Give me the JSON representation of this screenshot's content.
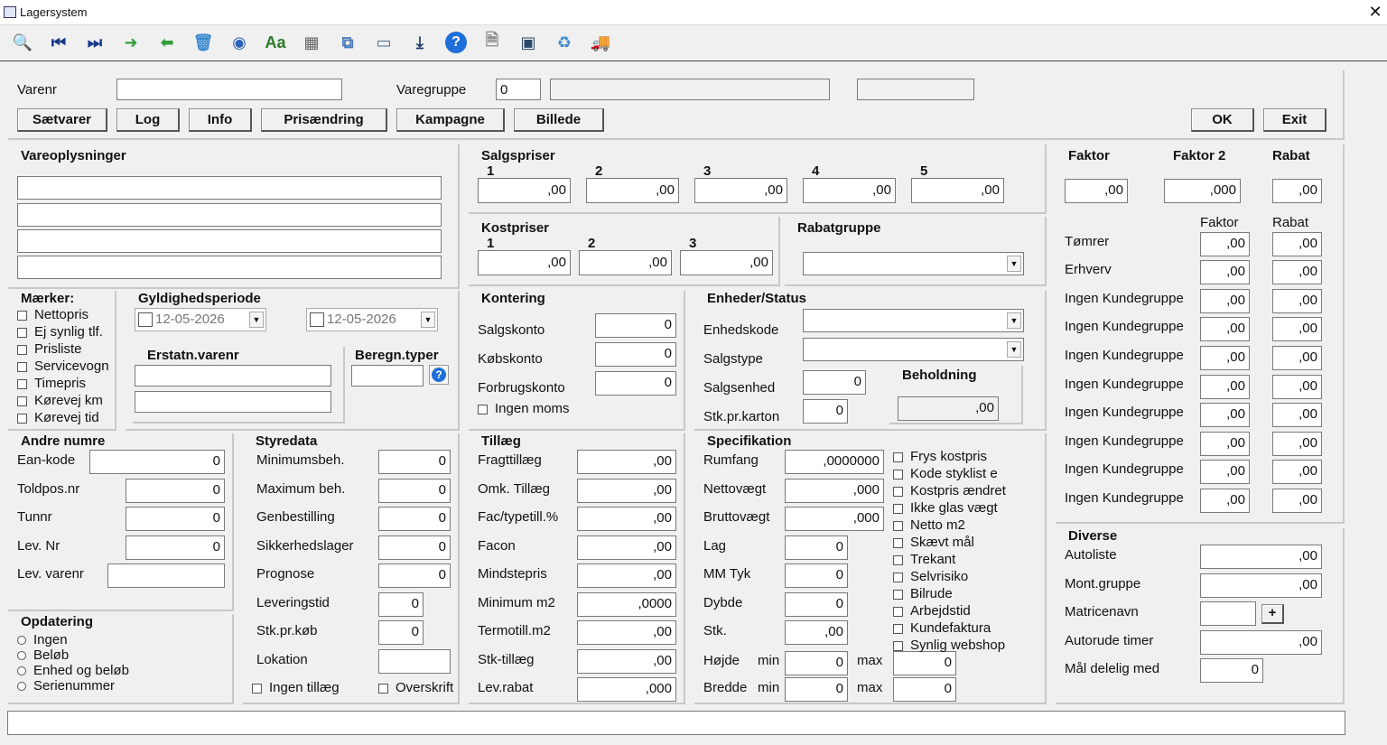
{
  "window": {
    "title": "Lagersystem",
    "close": "✕"
  },
  "toolbar": [
    {
      "name": "search-icon",
      "glyph": "🔍",
      "color": "#3a6fb0"
    },
    {
      "name": "first-record-icon",
      "glyph": "⏮",
      "color": "#1a3a8a"
    },
    {
      "name": "last-record-icon",
      "glyph": "⏭",
      "color": "#1a3a8a"
    },
    {
      "name": "forward-arrow-icon",
      "glyph": "➜",
      "color": "#2e9e3a"
    },
    {
      "name": "back-arrow-icon",
      "glyph": "⬅",
      "color": "#2e9e3a"
    },
    {
      "name": "trash-icon",
      "glyph": "🗑",
      "color": "#3a8ad0"
    },
    {
      "name": "disc-icon",
      "glyph": "◉",
      "color": "#2a62b8"
    },
    {
      "name": "font-icon",
      "glyph": "Aa",
      "color": "#2a7a2a"
    },
    {
      "name": "calculator-icon",
      "glyph": "▦",
      "color": "#666"
    },
    {
      "name": "copy-icon",
      "glyph": "⧉",
      "color": "#4a7ab8"
    },
    {
      "name": "print-icon",
      "glyph": "▭",
      "color": "#4a6a8a"
    },
    {
      "name": "download-icon",
      "glyph": "⤓",
      "color": "#1a3a6a"
    },
    {
      "name": "help-icon",
      "glyph": "?",
      "color": "#1e6fd9"
    },
    {
      "name": "document-icon",
      "glyph": "🗎",
      "color": "#888"
    },
    {
      "name": "screen-icon",
      "glyph": "▣",
      "color": "#2a4a6a"
    },
    {
      "name": "recycle-icon",
      "glyph": "♻",
      "color": "#3a8ad0"
    },
    {
      "name": "truck-icon",
      "glyph": "🚚",
      "color": "#2a6a3a"
    }
  ],
  "top": {
    "varenr_label": "Varenr",
    "varenr_value": "",
    "varegruppe_label": "Varegruppe",
    "varegruppe_value": "0",
    "varegruppe_name": "",
    "extra": ""
  },
  "buttons": {
    "saetvarer": "Sætvarer",
    "log": "Log",
    "info": "Info",
    "prisaendring": "Prisændring",
    "kampagne": "Kampagne",
    "billede": "Billede",
    "ok": "OK",
    "exit": "Exit"
  },
  "vareopl": {
    "title": "Vareoplysninger",
    "lines": [
      "",
      "",
      "",
      ""
    ]
  },
  "salgspriser": {
    "title": "Salgspriser",
    "cols": [
      "1",
      "2",
      "3",
      "4",
      "5"
    ],
    "values": [
      ",00",
      ",00",
      ",00",
      ",00",
      ",00"
    ]
  },
  "kostpriser": {
    "title": "Kostpriser",
    "cols": [
      "1",
      "2",
      "3"
    ],
    "values": [
      ",00",
      ",00",
      ",00"
    ]
  },
  "rabatgruppe": {
    "title": "Rabatgruppe",
    "value": ""
  },
  "faktor": {
    "h1": "Faktor",
    "h2": "Faktor 2",
    "h3": "Rabat",
    "v1": ",00",
    "v2": ",000",
    "v3": ",00",
    "sub_faktor": "Faktor",
    "sub_rabat": "Rabat",
    "rows": [
      {
        "label": "Tømrer",
        "faktor": ",00",
        "rabat": ",00"
      },
      {
        "label": "Erhverv",
        "faktor": ",00",
        "rabat": ",00"
      },
      {
        "label": "Ingen Kundegruppe",
        "faktor": ",00",
        "rabat": ",00"
      },
      {
        "label": "Ingen Kundegruppe",
        "faktor": ",00",
        "rabat": ",00"
      },
      {
        "label": "Ingen Kundegruppe",
        "faktor": ",00",
        "rabat": ",00"
      },
      {
        "label": "Ingen Kundegruppe",
        "faktor": ",00",
        "rabat": ",00"
      },
      {
        "label": "Ingen Kundegruppe",
        "faktor": ",00",
        "rabat": ",00"
      },
      {
        "label": "Ingen Kundegruppe",
        "faktor": ",00",
        "rabat": ",00"
      },
      {
        "label": "Ingen Kundegruppe",
        "faktor": ",00",
        "rabat": ",00"
      },
      {
        "label": "Ingen Kundegruppe",
        "faktor": ",00",
        "rabat": ",00"
      }
    ]
  },
  "maerker": {
    "title": "Mærker:",
    "items": [
      "Nettopris",
      "Ej synlig tlf.",
      "Prisliste",
      "Servicevogn",
      "Timepris",
      "Kørevej km",
      "Kørevej tid"
    ]
  },
  "gyldig": {
    "title": "Gyldighedsperiode",
    "from": "12-05-2026",
    "to": "12-05-2026",
    "erstatn_title": "Erstatn.varenr",
    "erstatn1": "",
    "erstatn2": "",
    "beregn_title": "Beregn.typer",
    "beregn_value": "",
    "help": "?"
  },
  "kontering": {
    "title": "Kontering",
    "rows": [
      {
        "label": "Salgskonto",
        "value": "0"
      },
      {
        "label": "Købskonto",
        "value": "0"
      },
      {
        "label": "Forbrugskonto",
        "value": "0"
      }
    ],
    "ingen_moms": "Ingen moms"
  },
  "enheder": {
    "title": "Enheder/Status",
    "enhedskode": "Enhedskode",
    "enhedskode_value": "",
    "salgstype": "Salgstype",
    "salgstype_value": "",
    "salgsenhed": "Salgsenhed",
    "salgsenhed_value": "0",
    "stkkarton": "Stk.pr.karton",
    "stkkarton_value": "0",
    "beholdning_title": "Beholdning",
    "beholdning_value": ",00"
  },
  "andre": {
    "title": "Andre numre",
    "ean": "Ean-kode",
    "ean_value": "0",
    "toldpos": "Toldpos.nr",
    "toldpos_value": "0",
    "tunnr": "Tunnr",
    "tunnr_value": "0",
    "levnr": "Lev. Nr",
    "levnr_value": "0",
    "levvarenr": "Lev. varenr",
    "levvarenr_value": ""
  },
  "opdatering": {
    "title": "Opdatering",
    "items": [
      "Ingen",
      "Beløb",
      "Enhed og beløb",
      "Serienummer"
    ]
  },
  "styredata": {
    "title": "Styredata",
    "rows": [
      {
        "label": "Minimumsbeh.",
        "value": "0"
      },
      {
        "label": "Maximum beh.",
        "value": "0"
      },
      {
        "label": "Genbestilling",
        "value": "0"
      },
      {
        "label": "Sikkerhedslager",
        "value": "0"
      },
      {
        "label": "Prognose",
        "value": "0"
      },
      {
        "label": "Leveringstid",
        "value": "0"
      },
      {
        "label": "Stk.pr.køb",
        "value": "0"
      },
      {
        "label": "Lokation",
        "value": ""
      }
    ],
    "ingen_tillaeg": "Ingen tillæg",
    "overskrift": "Overskrift"
  },
  "tillaeg": {
    "title": "Tillæg",
    "rows": [
      {
        "label": "Fragttillæg",
        "value": ",00"
      },
      {
        "label": "Omk. Tillæg",
        "value": ",00"
      },
      {
        "label": "Fac/typetill.%",
        "value": ",00"
      },
      {
        "label": "Facon",
        "value": ",00"
      },
      {
        "label": "Mindstepris",
        "value": ",00"
      },
      {
        "label": "Minimum m2",
        "value": ",0000"
      },
      {
        "label": "Termotill.m2",
        "value": ",00"
      },
      {
        "label": "Stk-tillæg",
        "value": ",00"
      },
      {
        "label": "Lev.rabat",
        "value": ",000"
      }
    ]
  },
  "spec": {
    "title": "Specifikation",
    "rows": [
      {
        "label": "Rumfang",
        "value": ",0000000"
      },
      {
        "label": "Nettovægt",
        "value": ",000"
      },
      {
        "label": "Bruttovægt",
        "value": ",000"
      },
      {
        "label": "Lag",
        "value": "0"
      },
      {
        "label": "MM Tyk",
        "value": "0"
      },
      {
        "label": "Dybde",
        "value": "0"
      },
      {
        "label": "Stk.",
        "value": ",00"
      }
    ],
    "hojde": "Højde",
    "bredde": "Bredde",
    "min": "min",
    "max": "max",
    "hojde_min": "0",
    "hojde_max": "0",
    "bredde_min": "0",
    "bredde_max": "0",
    "checks": [
      "Frys kostpris",
      "Kode styklist e",
      "Kostpris ændret",
      "Ikke glas vægt",
      "Netto m2",
      "Skævt mål",
      "Trekant",
      "Selvrisiko",
      "Bilrude",
      "Arbejdstid",
      "Kundefaktura",
      "Synlig webshop"
    ]
  },
  "diverse": {
    "title": "Diverse",
    "rows": [
      {
        "label": "Autoliste",
        "value": ",00"
      },
      {
        "label": "Mont.gruppe",
        "value": ",00"
      }
    ],
    "matricenavn": "Matricenavn",
    "matricenavn_value": "",
    "plus": "+",
    "autorude": "Autorude timer",
    "autorude_value": ",00",
    "maal": "Mål delelig med",
    "maal_value": "0"
  },
  "statusbar": ""
}
